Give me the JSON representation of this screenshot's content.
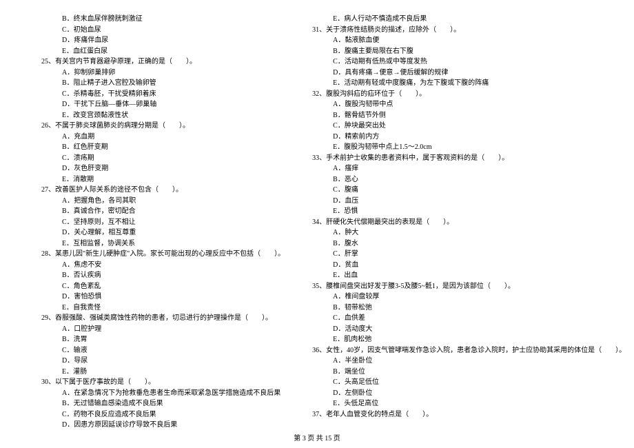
{
  "left_lines": [
    {
      "cls": "opt",
      "t": "B．终末血尿伴膀胱刺激征"
    },
    {
      "cls": "opt",
      "t": "C．初始血尿"
    },
    {
      "cls": "opt",
      "t": "D．疼痛伴血尿"
    },
    {
      "cls": "opt",
      "t": "E．血红蛋白尿"
    },
    {
      "cls": "q",
      "t": "25、有关宫内节育器避孕原理，正确的是（　　）。"
    },
    {
      "cls": "opt",
      "t": "A．抑制卵巢排卵"
    },
    {
      "cls": "opt",
      "t": "B．阻止精子进入宫腔及输卵管"
    },
    {
      "cls": "opt",
      "t": "C．杀精毒胚，干扰受精卵着床"
    },
    {
      "cls": "opt",
      "t": "D．干扰下丘脑—垂体—卵巢轴"
    },
    {
      "cls": "opt",
      "t": "E．改变宫颈黏液性状"
    },
    {
      "cls": "q",
      "t": "26、不属于肺炎球菌肺炎的病理分期是（　　）。"
    },
    {
      "cls": "opt",
      "t": "A．充血期"
    },
    {
      "cls": "opt",
      "t": "B．红色肝变期"
    },
    {
      "cls": "opt",
      "t": "C．溃疡期"
    },
    {
      "cls": "opt",
      "t": "D．灰色肝变期"
    },
    {
      "cls": "opt",
      "t": "E．消散期"
    },
    {
      "cls": "q",
      "t": "27、改善医护人际关系的途径不包含（　　）。"
    },
    {
      "cls": "opt",
      "t": "A．把握角色，各司其职"
    },
    {
      "cls": "opt",
      "t": "B．真诚合作，密切配合"
    },
    {
      "cls": "opt",
      "t": "C．坚持原则，互不相让"
    },
    {
      "cls": "opt",
      "t": "D．关心理解，相互尊重"
    },
    {
      "cls": "opt",
      "t": "E．互相监督，协调关系"
    },
    {
      "cls": "q",
      "t": "28、某患儿因\"新生儿硬肿症\"入院。家长可能出现的心理反应中不包括（　　）。"
    },
    {
      "cls": "opt",
      "t": "A．焦虑不安"
    },
    {
      "cls": "opt",
      "t": "B．否认疾病"
    },
    {
      "cls": "opt",
      "t": "C．角色紊乱"
    },
    {
      "cls": "opt",
      "t": "D．害怕恐惧"
    },
    {
      "cls": "opt",
      "t": "E．自我责怪"
    },
    {
      "cls": "q",
      "t": "29、吞服强酸、强碱类腐蚀性药物的患者，切忌进行的护理操作是（　　）。"
    },
    {
      "cls": "opt",
      "t": "A．口腔护理"
    },
    {
      "cls": "opt",
      "t": "B．洗胃"
    },
    {
      "cls": "opt",
      "t": "C．输液"
    },
    {
      "cls": "opt",
      "t": "D．导尿"
    },
    {
      "cls": "opt",
      "t": "E．灌肠"
    },
    {
      "cls": "q",
      "t": "30、以下属于医疗事故的是（　　）。"
    },
    {
      "cls": "opt",
      "t": "A．在紧急情况下为抢救垂危患者生命而采取紧急医学措施造成不良后果"
    },
    {
      "cls": "opt",
      "t": "B．无过错输血感染造成不良后果"
    },
    {
      "cls": "opt",
      "t": "C．药物不良反应造成不良后果"
    },
    {
      "cls": "opt",
      "t": "D．因患方原因延误诊疗导致不良后果"
    }
  ],
  "right_lines": [
    {
      "cls": "opt",
      "t": "E．病人行动不慎造成不良后果"
    },
    {
      "cls": "q",
      "t": "31、关于溃疡性结肠炎的描述，应除外（　　）。"
    },
    {
      "cls": "opt",
      "t": "A．黏液脓血便"
    },
    {
      "cls": "opt",
      "t": "B．腹痛主要局限在右下腹"
    },
    {
      "cls": "opt",
      "t": "C．活动期有低热或中等度发热"
    },
    {
      "cls": "opt",
      "t": "D．具有疼痛→便意→便后缓解的规律"
    },
    {
      "cls": "opt",
      "t": "E．活动期有轻或中度腹痛，为左下腹或下腹的阵痛"
    },
    {
      "cls": "q",
      "t": "32、腹股沟斜疝的疝环位于（　　）。"
    },
    {
      "cls": "opt",
      "t": "A．腹股沟韧带中点"
    },
    {
      "cls": "opt",
      "t": "B．髂骨结节外侧"
    },
    {
      "cls": "opt",
      "t": "C．肿块最突出处"
    },
    {
      "cls": "opt",
      "t": "D．精索前内方"
    },
    {
      "cls": "opt",
      "t": "E．腹股沟韧带中点上1.5～2.0cm"
    },
    {
      "cls": "q",
      "t": "33、手术前护士收集的患者资料中，属于客观资料的是（　　）。"
    },
    {
      "cls": "opt",
      "t": "A．瘙痒"
    },
    {
      "cls": "opt",
      "t": "B．恶心"
    },
    {
      "cls": "opt",
      "t": "C．腹痛"
    },
    {
      "cls": "opt",
      "t": "D．血压"
    },
    {
      "cls": "opt",
      "t": "E．恐惧"
    },
    {
      "cls": "q",
      "t": "34、肝硬化失代偿期最突出的表现是（　　）。"
    },
    {
      "cls": "opt",
      "t": "A．肿大"
    },
    {
      "cls": "opt",
      "t": "B．腹水"
    },
    {
      "cls": "opt",
      "t": "C．肝掌"
    },
    {
      "cls": "opt",
      "t": "D．贫血"
    },
    {
      "cls": "opt",
      "t": "E．出血"
    },
    {
      "cls": "q",
      "t": "35、腰椎间盘突出好发于腰3-5及腰5~骶1，是因为该部位（　　）。"
    },
    {
      "cls": "opt",
      "t": "A．椎间盘较厚"
    },
    {
      "cls": "opt",
      "t": "B．韧带松弛"
    },
    {
      "cls": "opt",
      "t": "C．血供差"
    },
    {
      "cls": "opt",
      "t": "D．活动度大"
    },
    {
      "cls": "opt",
      "t": "E．肌肉松弛"
    },
    {
      "cls": "q",
      "t": "36、女性，40岁，因支气管哮喘发作急诊入院，患者急诊入院时，护士应协助其采用的体位是（　　）。"
    },
    {
      "cls": "opt",
      "t": "A．半坐卧位"
    },
    {
      "cls": "opt",
      "t": "B．端坐位"
    },
    {
      "cls": "opt",
      "t": "C．头高足低位"
    },
    {
      "cls": "opt",
      "t": "D．左侧卧位"
    },
    {
      "cls": "opt",
      "t": "E．头低足高位"
    },
    {
      "cls": "q",
      "t": "37、老年人血管变化的特点是（　　）。"
    }
  ],
  "footer": "第 3 页 共 15 页"
}
